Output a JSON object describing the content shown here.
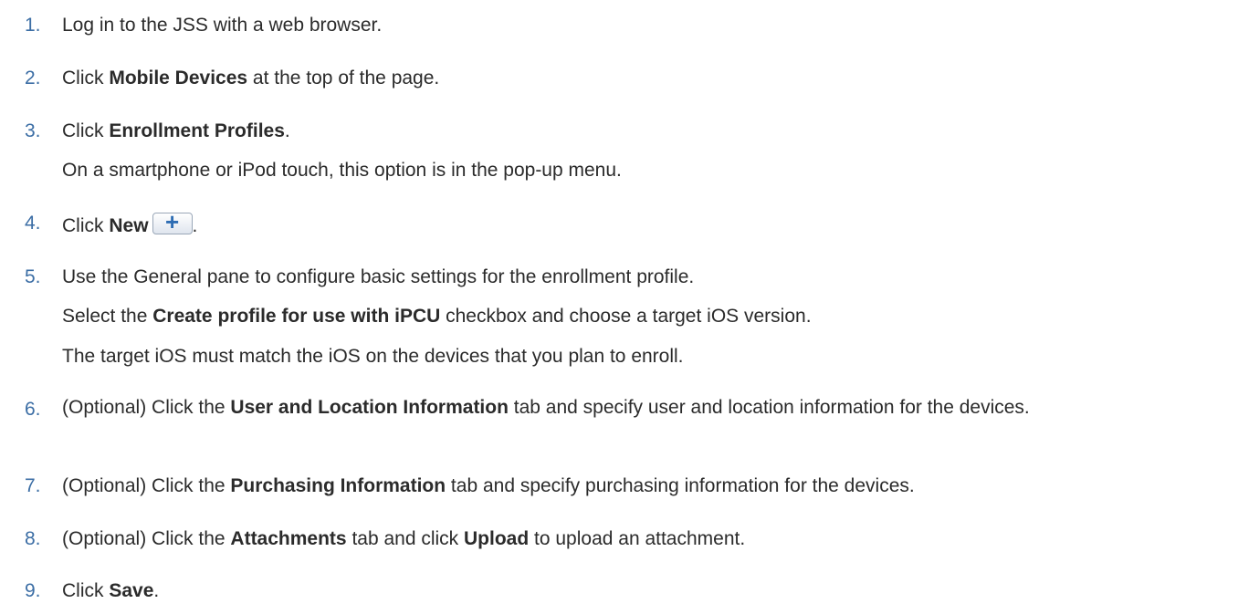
{
  "steps": [
    {
      "number": "1.",
      "lines": [
        {
          "a": "Log in to the JSS with a web browser."
        }
      ]
    },
    {
      "number": "2.",
      "lines": [
        {
          "a": "Click ",
          "b": "Mobile Devices",
          "c": " at the top of the page."
        }
      ]
    },
    {
      "number": "3.",
      "lines": [
        {
          "a": "Click ",
          "b": "Enrollment Profiles",
          "c": "."
        },
        {
          "a": "On a smartphone or iPod touch, this option is in the pop-up menu."
        }
      ]
    },
    {
      "number": "4.",
      "lines": [
        {
          "a": "Click ",
          "b": "New",
          "icon": "+",
          "c": "."
        }
      ]
    },
    {
      "number": "5.",
      "lines": [
        {
          "a": "Use the General pane to configure basic settings for the enrollment profile."
        },
        {
          "a": "Select the ",
          "b": "Create profile for use with iPCU",
          "c": " checkbox and choose a target iOS version."
        },
        {
          "a": "The target iOS must match the iOS on the devices that you plan to enroll."
        }
      ]
    },
    {
      "number": "6.",
      "lines": [
        {
          "a": "(Optional) Click the ",
          "b": "User and Location Information",
          "c": " tab and specify user and location information for the devices."
        }
      ]
    },
    {
      "number": "7.",
      "lines": [
        {
          "a": "(Optional) Click the ",
          "b": "Purchasing Information",
          "c": " tab and specify purchasing information for the devices."
        }
      ]
    },
    {
      "number": "8.",
      "lines": [
        {
          "a": "(Optional) Click the ",
          "b": "Attachments",
          "c": " tab and click ",
          "d": "Upload",
          "e": " to upload an attachment."
        }
      ]
    },
    {
      "number": "9.",
      "lines": [
        {
          "a": "Click ",
          "b": "Save",
          "c": "."
        }
      ]
    }
  ],
  "colors": {
    "number": "#3c6ea5",
    "text": "#2b2b2b",
    "button_plus": "#2e6db3"
  },
  "icons": {
    "new_button": "plus-icon"
  }
}
